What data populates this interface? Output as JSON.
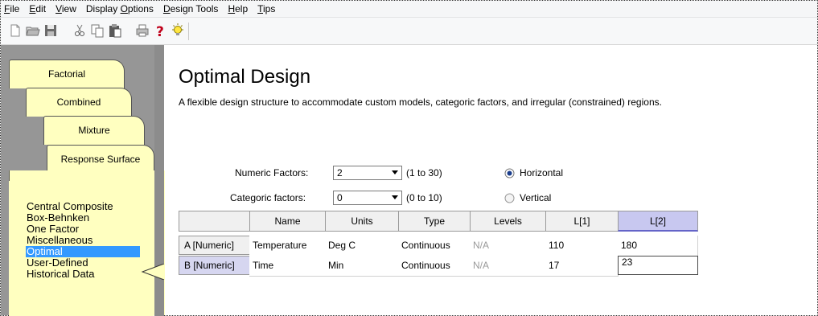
{
  "menu": [
    {
      "label": "File",
      "u": "F",
      "rest": "ile"
    },
    {
      "label": "Edit",
      "u": "E",
      "rest": "dit"
    },
    {
      "label": "View",
      "u": "V",
      "rest": "iew"
    },
    {
      "label": "Display Options",
      "u": "O",
      "pre": "Display ",
      "rest": "ptions"
    },
    {
      "label": "Design Tools",
      "u": "D",
      "rest": "esign Tools"
    },
    {
      "label": "Help",
      "u": "H",
      "rest": "elp"
    },
    {
      "label": "Tips",
      "u": "T",
      "rest": "ips"
    }
  ],
  "tabs": [
    "Factorial",
    "Combined",
    "Mixture",
    "Response Surface"
  ],
  "designs": [
    "Central Composite",
    "Box-Behnken",
    "One Factor",
    "Miscellaneous",
    "Optimal",
    "User-Defined",
    "Historical Data"
  ],
  "selected_design": "Optimal",
  "title": "Optimal Design",
  "subtitle": "A flexible design structure to accommodate custom models, categoric factors, and irregular (constrained) regions.",
  "numeric": {
    "label": "Numeric Factors:",
    "value": "2",
    "range": "(1 to 30)"
  },
  "categoric": {
    "label": "Categoric factors:",
    "value": "0",
    "range": "(0 to 10)"
  },
  "orientation": {
    "horizontal": "Horizontal",
    "vertical": "Vertical",
    "selected": "horizontal"
  },
  "table": {
    "headers": [
      "Name",
      "Units",
      "Type",
      "Levels",
      "L[1]",
      "L[2]"
    ],
    "rows": [
      {
        "id": "A [Numeric]",
        "cells": [
          "Temperature",
          "Deg C",
          "Continuous",
          "N/A",
          "110",
          "180"
        ]
      },
      {
        "id": "B [Numeric]",
        "cells": [
          "Time",
          "Min",
          "Continuous",
          "N/A",
          "17",
          "23"
        ]
      }
    ]
  },
  "colors": {
    "panel": "#ffffc0",
    "selection": "#3399ff",
    "active_header": "#c8c8f0"
  }
}
